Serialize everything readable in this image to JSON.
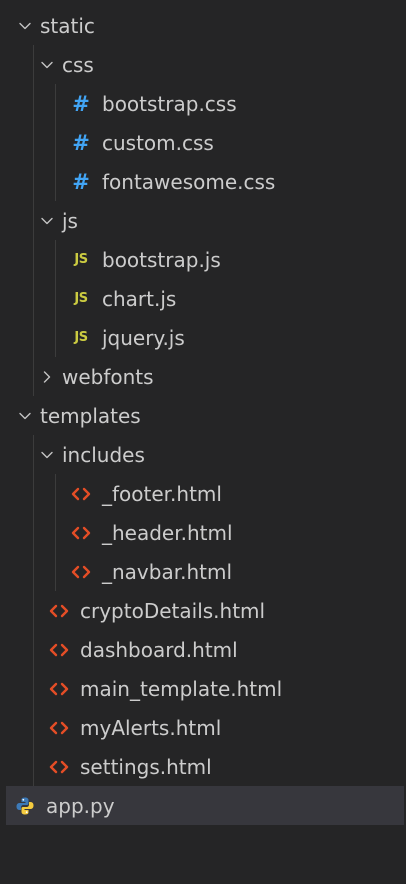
{
  "explorer": {
    "items": [
      {
        "label": "static",
        "type": "folder",
        "expanded": true,
        "depth": 0
      },
      {
        "label": "css",
        "type": "folder",
        "expanded": true,
        "depth": 1
      },
      {
        "label": "bootstrap.css",
        "type": "css",
        "depth": 2
      },
      {
        "label": "custom.css",
        "type": "css",
        "depth": 2
      },
      {
        "label": "fontawesome.css",
        "type": "css",
        "depth": 2
      },
      {
        "label": "js",
        "type": "folder",
        "expanded": true,
        "depth": 1
      },
      {
        "label": "bootstrap.js",
        "type": "js",
        "depth": 2
      },
      {
        "label": "chart.js",
        "type": "js",
        "depth": 2
      },
      {
        "label": "jquery.js",
        "type": "js",
        "depth": 2
      },
      {
        "label": "webfonts",
        "type": "folder",
        "expanded": false,
        "depth": 1
      },
      {
        "label": "templates",
        "type": "folder",
        "expanded": true,
        "depth": 0
      },
      {
        "label": "includes",
        "type": "folder",
        "expanded": true,
        "depth": 1
      },
      {
        "label": "_footer.html",
        "type": "html",
        "depth": 2
      },
      {
        "label": "_header.html",
        "type": "html",
        "depth": 2
      },
      {
        "label": "_navbar.html",
        "type": "html",
        "depth": 2
      },
      {
        "label": "cryptoDetails.html",
        "type": "html",
        "depth": 1
      },
      {
        "label": "dashboard.html",
        "type": "html",
        "depth": 1
      },
      {
        "label": "main_template.html",
        "type": "html",
        "depth": 1
      },
      {
        "label": "myAlerts.html",
        "type": "html",
        "depth": 1
      },
      {
        "label": "settings.html",
        "type": "html",
        "depth": 1
      },
      {
        "label": "app.py",
        "type": "python",
        "depth": 0,
        "selected": true
      }
    ]
  },
  "icons": {
    "css_glyph": "#",
    "js_glyph": "JS"
  },
  "colors": {
    "background": "#252526",
    "selected_row": "#37373d",
    "css_icon": "#42a5f5",
    "js_icon": "#cbcb41",
    "html_icon": "#e44d26",
    "python_blue": "#3d7ab8",
    "python_yellow": "#f5cb3f",
    "text": "#cccccc"
  }
}
